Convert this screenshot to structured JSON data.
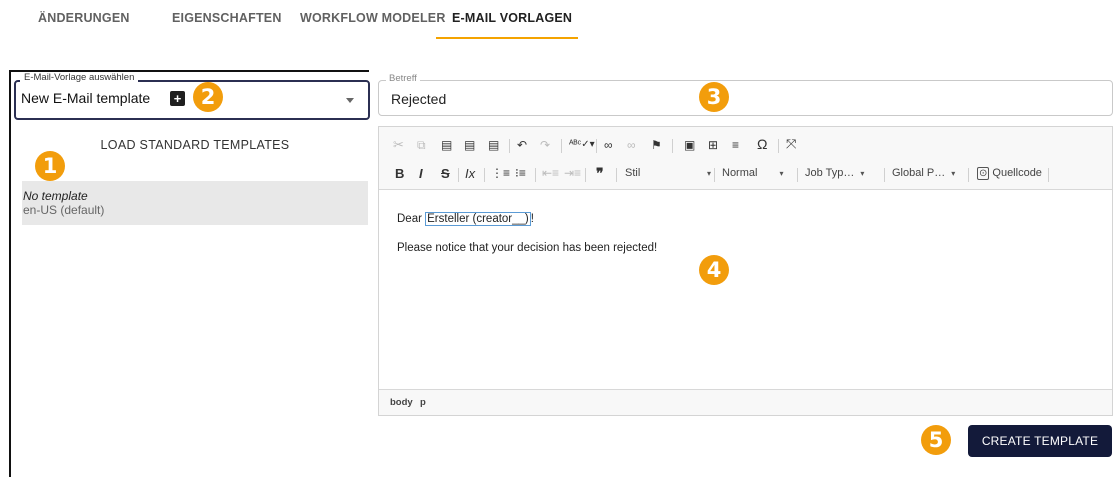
{
  "tabs": [
    {
      "label": "ÄNDERUNGEN"
    },
    {
      "label": "EIGENSCHAFTEN"
    },
    {
      "label": "WORKFLOW MODELER"
    },
    {
      "label": "E-MAIL VORLAGEN",
      "active": true
    }
  ],
  "template_select": {
    "label": "E-Mail-Vorlage auswählen",
    "value": "New E-Mail template",
    "icon": "plus-square-icon"
  },
  "left_panel": {
    "load_button": "LOAD STANDARD TEMPLATES",
    "templates": [
      {
        "name": "No template",
        "language": "en-US (default)"
      }
    ]
  },
  "subject": {
    "label": "Betreff",
    "value": "Rejected"
  },
  "editor": {
    "toolbar_row1_icons": [
      "cut-icon",
      "copy-icon",
      "paste-icon",
      "paste-text-icon",
      "paste-word-icon",
      "undo-icon",
      "redo-icon",
      "spellcheck-icon",
      "link-icon",
      "unlink-icon",
      "anchor-icon",
      "image-icon",
      "table-icon",
      "horizontal-line-icon",
      "special-char-icon",
      "maximize-icon"
    ],
    "toolbar_row2_icons": [
      "bold-icon",
      "italic-icon",
      "strike-icon",
      "remove-format-icon",
      "numbered-list-icon",
      "bulleted-list-icon",
      "outdent-icon",
      "indent-icon",
      "blockquote-icon"
    ],
    "combos": {
      "style": "Stil",
      "format": "Normal",
      "job_type": "Job Typ…",
      "global": "Global P…",
      "source": "Quellcode"
    },
    "content": {
      "greeting": "Dear",
      "placeholder": "Ersteller (creator__)",
      "greeting_end": "!",
      "body": "Please notice that your decision has been rejected!"
    },
    "path": [
      "body",
      "p"
    ]
  },
  "create_button": "CREATE TEMPLATE",
  "badges": [
    "1",
    "2",
    "3",
    "4",
    "5"
  ],
  "colors": {
    "accent": "#f4a300",
    "badge": "#f29d0c",
    "primary_button": "#131a3a"
  }
}
